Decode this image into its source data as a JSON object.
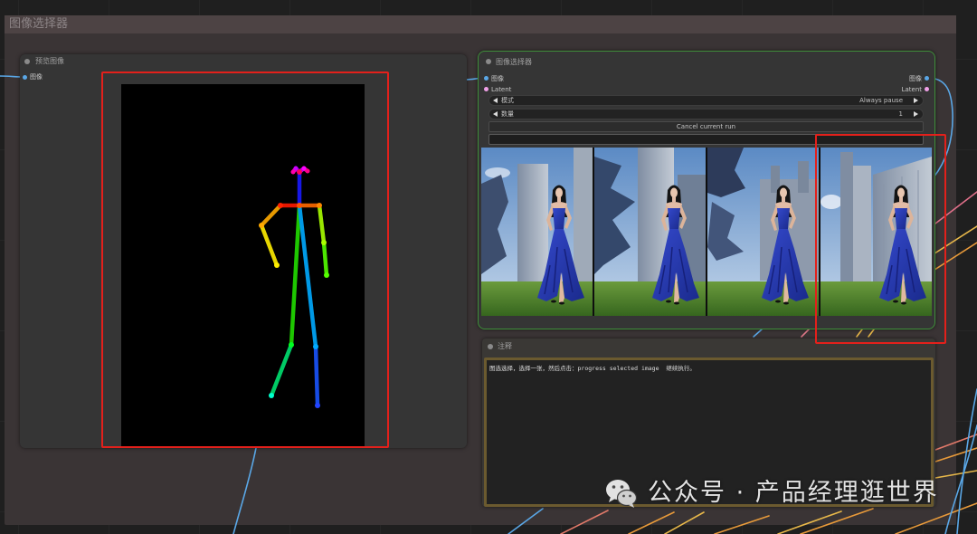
{
  "group": {
    "title": "图像选择器"
  },
  "preview_node": {
    "title": "预览图像",
    "input_label": "图像"
  },
  "selector_node": {
    "title": "图像选择器",
    "inputs": [
      "图像",
      "Latent"
    ],
    "outputs": [
      "图像",
      "Latent"
    ],
    "mode_label": "模式",
    "mode_value": "Always pause",
    "count_label": "数量",
    "count_value": "1",
    "cancel_button": "Cancel current run"
  },
  "note_node": {
    "title": "注释",
    "text": "图选选择，选择一张，然后点击：progress selected image  继续执行。"
  },
  "watermark": {
    "text": "公众号 · 产品经理逛世界",
    "icon": "wechat-icon"
  },
  "icons": {
    "node_status": "node-dot",
    "combo_prev": "arrow-left-icon",
    "combo_next": "arrow-right-icon"
  },
  "colors": {
    "link_image": "#5aa7e6",
    "link_latent": "#f0a0e8",
    "selected_border": "#3f8f3a",
    "annotation_red": "#e3201b",
    "note_border": "#6b5a2f"
  }
}
